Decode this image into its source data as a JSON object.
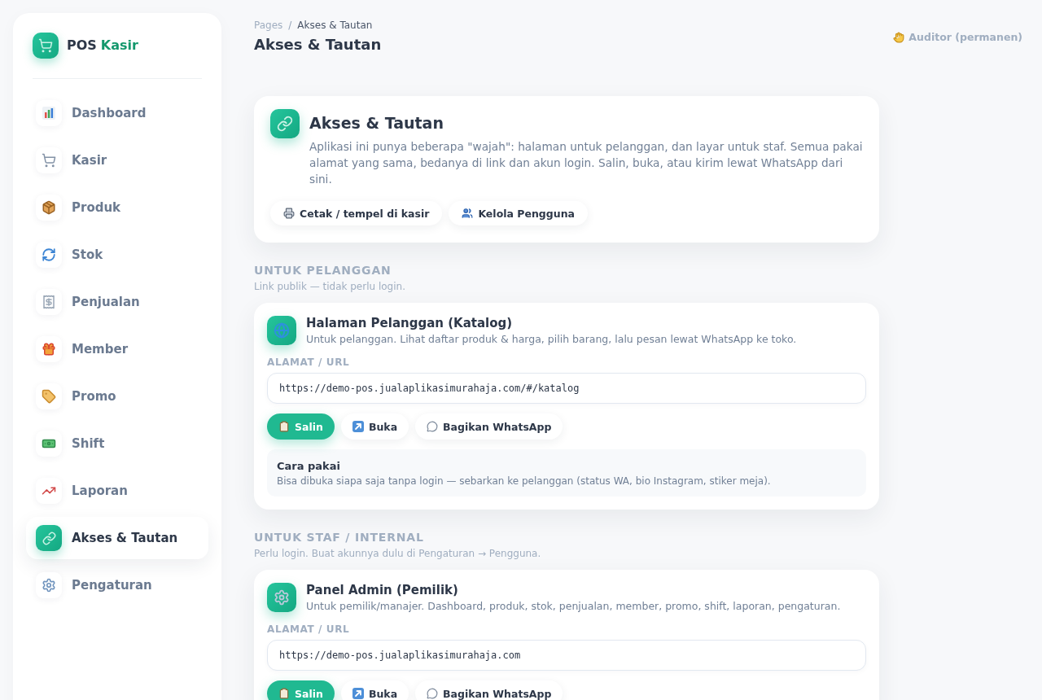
{
  "sidebar": {
    "brand": {
      "name": "POS",
      "accent": "Kasir"
    },
    "items": [
      {
        "label": "Dashboard",
        "selected": false
      },
      {
        "label": "Kasir",
        "selected": false
      },
      {
        "label": "Produk",
        "selected": false
      },
      {
        "label": "Stok",
        "selected": false
      },
      {
        "label": "Penjualan",
        "selected": false
      },
      {
        "label": "Member",
        "selected": false
      },
      {
        "label": "Promo",
        "selected": false
      },
      {
        "label": "Shift",
        "selected": false
      },
      {
        "label": "Laporan",
        "selected": false
      },
      {
        "label": "Akses & Tautan",
        "selected": true
      },
      {
        "label": "Pengaturan",
        "selected": false
      }
    ]
  },
  "header": {
    "breadcrumb": {
      "items": [
        "Pages",
        "Akses & Tautan"
      ],
      "separator": "/"
    },
    "title": "Akses & Tautan",
    "user": "Auditor (permanen)"
  },
  "intro": {
    "title": "Akses & Tautan",
    "description": "Aplikasi ini punya beberapa \"wajah\": halaman untuk pelanggan, dan layar untuk staf. Semua pakai alamat yang sama, bedanya di link dan akun login. Salin, buka, atau kirim lewat WhatsApp dari sini.",
    "buttons": [
      "Cetak / tempel di kasir",
      "Kelola Pengguna"
    ]
  },
  "sections": [
    {
      "heading": "UNTUK PELANGGAN",
      "subheading": "Link publik — tidak perlu login.",
      "cards": [
        {
          "title": "Halaman Pelanggan (Katalog)",
          "description": "Untuk pelanggan. Lihat daftar produk & harga, pilih barang, lalu pesan lewat WhatsApp ke toko.",
          "url_label": "ALAMAT / URL",
          "url": "https://demo-pos.jualaplikasimurahaja.com/#/katalog",
          "buttons": [
            {
              "label": "Salin",
              "kind": "primary"
            },
            {
              "label": "Buka",
              "kind": "secondary"
            },
            {
              "label": "Bagikan WhatsApp",
              "kind": "secondary"
            }
          ],
          "note": {
            "title": "Cara pakai",
            "text": "Bisa dibuka siapa saja tanpa login — sebarkan ke pelanggan (status WA, bio Instagram, stiker meja)."
          }
        }
      ]
    },
    {
      "heading": "UNTUK STAF / INTERNAL",
      "subheading": "Perlu login. Buat akunnya dulu di Pengaturan → Pengguna.",
      "cards": [
        {
          "title": "Panel Admin (Pemilik)",
          "description": "Untuk pemilik/manajer. Dashboard, produk, stok, penjualan, member, promo, shift, laporan, pengaturan.",
          "url_label": "ALAMAT / URL",
          "url": "https://demo-pos.jualaplikasimurahaja.com",
          "buttons": [
            {
              "label": "Salin",
              "kind": "primary"
            },
            {
              "label": "Buka",
              "kind": "secondary"
            },
            {
              "label": "Bagikan WhatsApp",
              "kind": "secondary"
            }
          ]
        }
      ]
    }
  ]
}
